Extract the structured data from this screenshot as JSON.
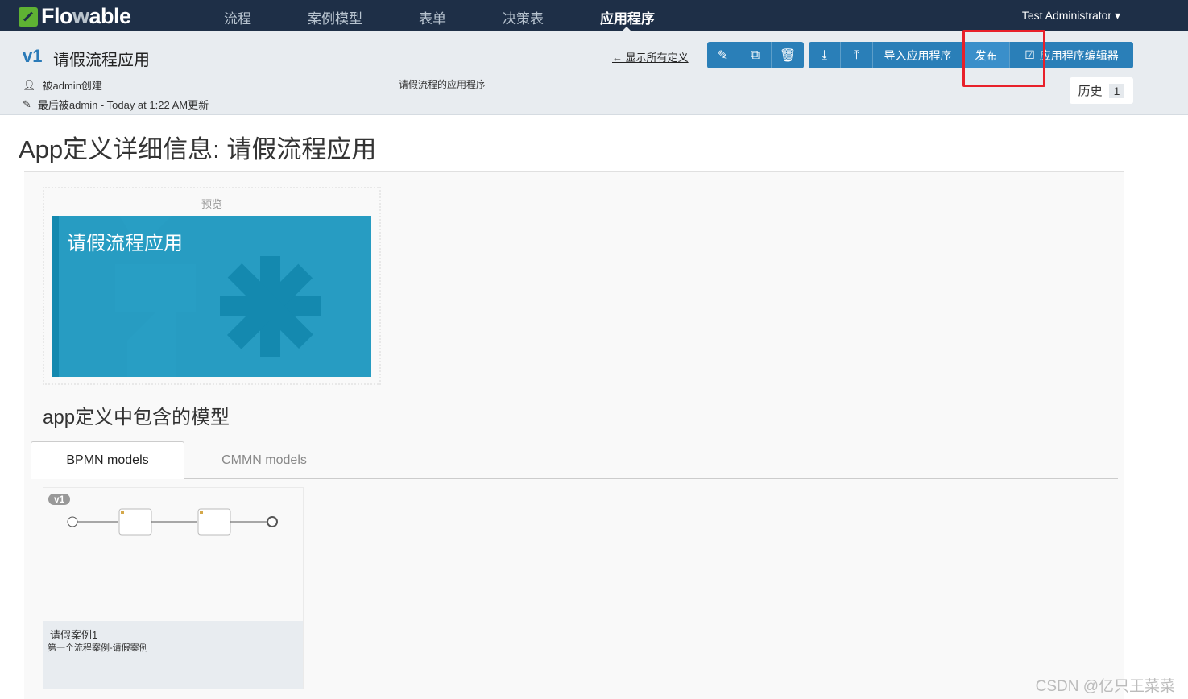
{
  "nav": {
    "brand": "Flowable",
    "items": [
      "流程",
      "案例模型",
      "表单",
      "决策表",
      "应用程序"
    ],
    "active": "应用程序",
    "user": "Test Administrator"
  },
  "header": {
    "version": "v1",
    "title": "请假流程应用",
    "created_by": "被admin创建",
    "updated": "最后被admin - Today at 1:22 AM更新",
    "description": "请假流程的应用程序",
    "back_link": "← 显示所有定义",
    "buttons": {
      "edit": "edit-icon",
      "copy": "copy-icon",
      "delete": "trash-icon",
      "export": "download-icon",
      "export_bar": "upload-icon",
      "import": "导入应用程序",
      "publish": "发布",
      "editor": "应用程序编辑器"
    },
    "history_label": "历史",
    "history_count": "1"
  },
  "main": {
    "title": "App定义详细信息: 请假流程应用",
    "preview_label": "预览",
    "card_title": "请假流程应用",
    "card_color": "#279cc2",
    "models_heading": "app定义中包含的模型",
    "tabs": [
      "BPMN models",
      "CMMN models"
    ],
    "models": [
      {
        "version": "v1",
        "name": "请假案例1",
        "description": "第一个流程案例-请假案例"
      }
    ]
  },
  "watermark": "CSDN @亿只王菜菜",
  "highlight_color": "#e8202a"
}
